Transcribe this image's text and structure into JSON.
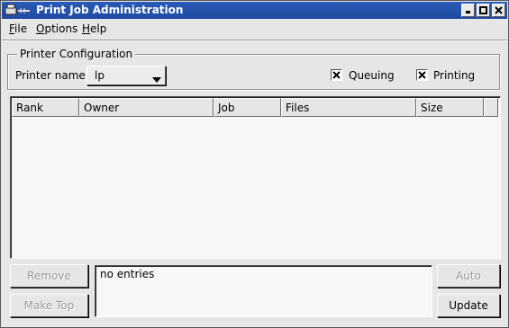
{
  "window": {
    "title": "Print Job Administration"
  },
  "menubar": {
    "items": [
      {
        "label": "File",
        "mnemonic": "F",
        "rest": "ile"
      },
      {
        "label": "Options",
        "mnemonic": "O",
        "rest": "ptions"
      },
      {
        "label": "Help",
        "mnemonic": "H",
        "rest": "elp"
      }
    ]
  },
  "config": {
    "group_title": "Printer Configuration",
    "printer_label": "Printer name:",
    "printer_value": "lp",
    "queuing_label": "Queuing",
    "queuing_checked": true,
    "printing_label": "Printing",
    "printing_checked": true
  },
  "table": {
    "columns": [
      "Rank",
      "Owner",
      "Job",
      "Files",
      "Size"
    ],
    "rows": []
  },
  "buttons": {
    "remove": "Remove",
    "make_top": "Make Top",
    "auto": "Auto",
    "update": "Update"
  },
  "status": {
    "text": "no entries"
  },
  "icons": {
    "window_menu": "printer-icon",
    "minimize": "minimize-icon",
    "maximize": "maximize-icon",
    "close": "close-icon",
    "combo_arrow": "triangle-down-icon",
    "check": "x-check-icon"
  },
  "colors": {
    "titlebar": "#1f4aa0",
    "background": "#e6e6e6",
    "list_background": "#f6f8f6"
  }
}
